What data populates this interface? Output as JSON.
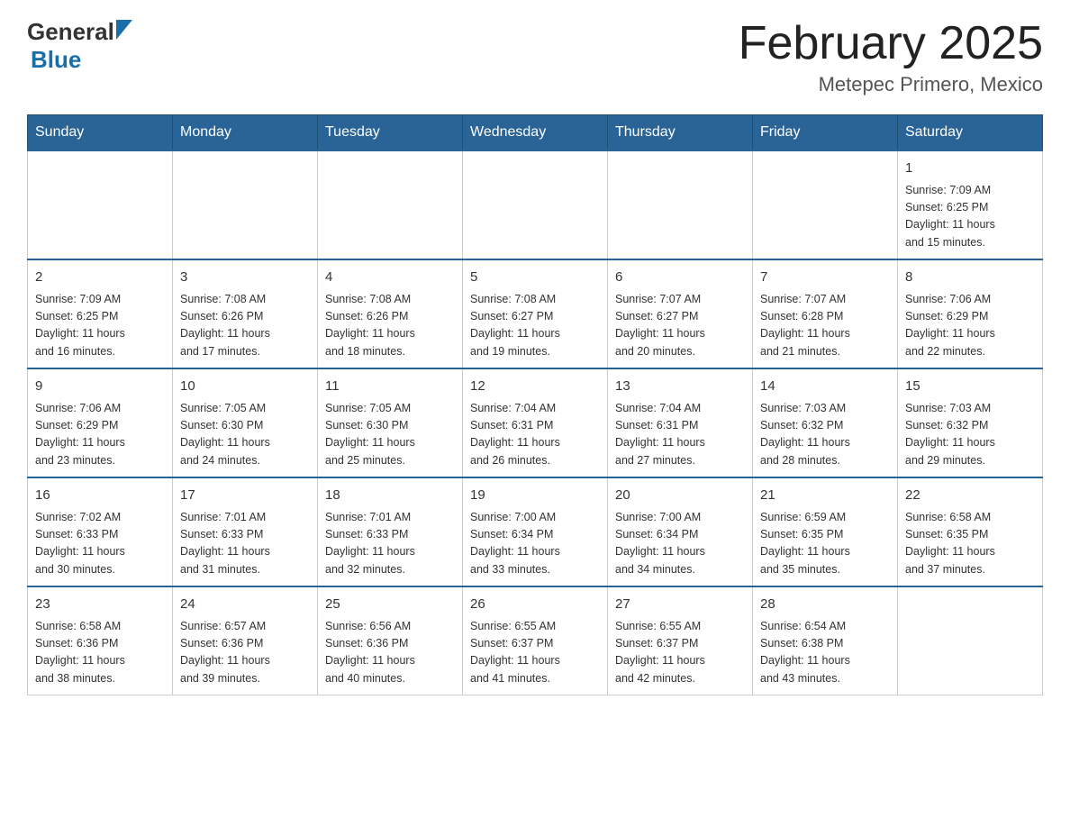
{
  "header": {
    "logo_general": "General",
    "logo_blue": "Blue",
    "month_title": "February 2025",
    "location": "Metepec Primero, Mexico"
  },
  "weekdays": [
    "Sunday",
    "Monday",
    "Tuesday",
    "Wednesday",
    "Thursday",
    "Friday",
    "Saturday"
  ],
  "weeks": [
    [
      {
        "day": "",
        "info": ""
      },
      {
        "day": "",
        "info": ""
      },
      {
        "day": "",
        "info": ""
      },
      {
        "day": "",
        "info": ""
      },
      {
        "day": "",
        "info": ""
      },
      {
        "day": "",
        "info": ""
      },
      {
        "day": "1",
        "info": "Sunrise: 7:09 AM\nSunset: 6:25 PM\nDaylight: 11 hours\nand 15 minutes."
      }
    ],
    [
      {
        "day": "2",
        "info": "Sunrise: 7:09 AM\nSunset: 6:25 PM\nDaylight: 11 hours\nand 16 minutes."
      },
      {
        "day": "3",
        "info": "Sunrise: 7:08 AM\nSunset: 6:26 PM\nDaylight: 11 hours\nand 17 minutes."
      },
      {
        "day": "4",
        "info": "Sunrise: 7:08 AM\nSunset: 6:26 PM\nDaylight: 11 hours\nand 18 minutes."
      },
      {
        "day": "5",
        "info": "Sunrise: 7:08 AM\nSunset: 6:27 PM\nDaylight: 11 hours\nand 19 minutes."
      },
      {
        "day": "6",
        "info": "Sunrise: 7:07 AM\nSunset: 6:27 PM\nDaylight: 11 hours\nand 20 minutes."
      },
      {
        "day": "7",
        "info": "Sunrise: 7:07 AM\nSunset: 6:28 PM\nDaylight: 11 hours\nand 21 minutes."
      },
      {
        "day": "8",
        "info": "Sunrise: 7:06 AM\nSunset: 6:29 PM\nDaylight: 11 hours\nand 22 minutes."
      }
    ],
    [
      {
        "day": "9",
        "info": "Sunrise: 7:06 AM\nSunset: 6:29 PM\nDaylight: 11 hours\nand 23 minutes."
      },
      {
        "day": "10",
        "info": "Sunrise: 7:05 AM\nSunset: 6:30 PM\nDaylight: 11 hours\nand 24 minutes."
      },
      {
        "day": "11",
        "info": "Sunrise: 7:05 AM\nSunset: 6:30 PM\nDaylight: 11 hours\nand 25 minutes."
      },
      {
        "day": "12",
        "info": "Sunrise: 7:04 AM\nSunset: 6:31 PM\nDaylight: 11 hours\nand 26 minutes."
      },
      {
        "day": "13",
        "info": "Sunrise: 7:04 AM\nSunset: 6:31 PM\nDaylight: 11 hours\nand 27 minutes."
      },
      {
        "day": "14",
        "info": "Sunrise: 7:03 AM\nSunset: 6:32 PM\nDaylight: 11 hours\nand 28 minutes."
      },
      {
        "day": "15",
        "info": "Sunrise: 7:03 AM\nSunset: 6:32 PM\nDaylight: 11 hours\nand 29 minutes."
      }
    ],
    [
      {
        "day": "16",
        "info": "Sunrise: 7:02 AM\nSunset: 6:33 PM\nDaylight: 11 hours\nand 30 minutes."
      },
      {
        "day": "17",
        "info": "Sunrise: 7:01 AM\nSunset: 6:33 PM\nDaylight: 11 hours\nand 31 minutes."
      },
      {
        "day": "18",
        "info": "Sunrise: 7:01 AM\nSunset: 6:33 PM\nDaylight: 11 hours\nand 32 minutes."
      },
      {
        "day": "19",
        "info": "Sunrise: 7:00 AM\nSunset: 6:34 PM\nDaylight: 11 hours\nand 33 minutes."
      },
      {
        "day": "20",
        "info": "Sunrise: 7:00 AM\nSunset: 6:34 PM\nDaylight: 11 hours\nand 34 minutes."
      },
      {
        "day": "21",
        "info": "Sunrise: 6:59 AM\nSunset: 6:35 PM\nDaylight: 11 hours\nand 35 minutes."
      },
      {
        "day": "22",
        "info": "Sunrise: 6:58 AM\nSunset: 6:35 PM\nDaylight: 11 hours\nand 37 minutes."
      }
    ],
    [
      {
        "day": "23",
        "info": "Sunrise: 6:58 AM\nSunset: 6:36 PM\nDaylight: 11 hours\nand 38 minutes."
      },
      {
        "day": "24",
        "info": "Sunrise: 6:57 AM\nSunset: 6:36 PM\nDaylight: 11 hours\nand 39 minutes."
      },
      {
        "day": "25",
        "info": "Sunrise: 6:56 AM\nSunset: 6:36 PM\nDaylight: 11 hours\nand 40 minutes."
      },
      {
        "day": "26",
        "info": "Sunrise: 6:55 AM\nSunset: 6:37 PM\nDaylight: 11 hours\nand 41 minutes."
      },
      {
        "day": "27",
        "info": "Sunrise: 6:55 AM\nSunset: 6:37 PM\nDaylight: 11 hours\nand 42 minutes."
      },
      {
        "day": "28",
        "info": "Sunrise: 6:54 AM\nSunset: 6:38 PM\nDaylight: 11 hours\nand 43 minutes."
      },
      {
        "day": "",
        "info": ""
      }
    ]
  ]
}
